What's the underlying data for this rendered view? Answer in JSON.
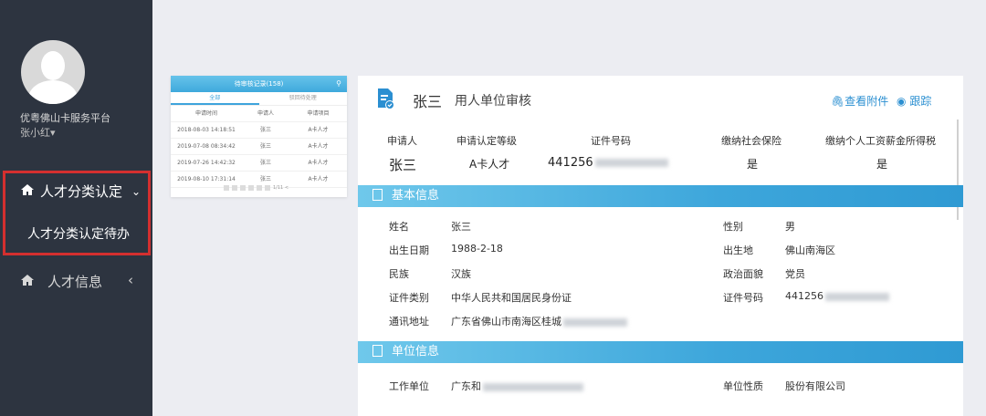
{
  "sidebar": {
    "platform": "优粤佛山卡服务平台",
    "user": "张小红▾",
    "menu_active": "人才分类认定",
    "menu_active_sub": "人才分类认定待办",
    "menu_other": "人才信息"
  },
  "mini": {
    "header": "待审核记录(158)",
    "tabs": [
      "全部",
      "驳回待处理"
    ],
    "columns": [
      "申请时间",
      "申请人",
      "申请项目"
    ],
    "rows": [
      [
        "2018-08-03 14:18:51",
        "张三",
        "A卡人才"
      ],
      [
        "2019-07-08 08:34:42",
        "张三",
        "A卡人才"
      ],
      [
        "2019-07-26 14:42:32",
        "张三",
        "A卡人才"
      ],
      [
        "2019-08-10 17:31:14",
        "张三",
        "A卡人才"
      ]
    ],
    "pager": "1/11 <"
  },
  "card": {
    "name": "张三",
    "title": "用人单位审核",
    "link_attachment": "查看附件",
    "link_track": "跟踪",
    "summary_labels": [
      "申请人",
      "申请认定等级",
      "证件号码",
      "缴纳社会保险",
      "缴纳个人工资薪金所得税"
    ],
    "summary_values": [
      "张三",
      "A卡人才",
      "441256",
      "是",
      "是"
    ],
    "basic_title": "基本信息",
    "basic": {
      "name_label": "姓名",
      "name": "张三",
      "gender_label": "性别",
      "gender": "男",
      "birth_label": "出生日期",
      "birth": "1988-2-18",
      "birthplace_label": "出生地",
      "birthplace": "佛山南海区",
      "ethnic_label": "民族",
      "ethnic": "汉族",
      "political_label": "政治面貌",
      "political": "党员",
      "idtype_label": "证件类别",
      "idtype": "中华人民共和国居民身份证",
      "idno_label": "证件号码",
      "idno": "441256",
      "addr_label": "通讯地址",
      "addr": "广东省佛山市南海区桂城"
    },
    "unit_title": "单位信息",
    "unit": {
      "work_label": "工作单位",
      "work": "广东和",
      "nature_label": "单位性质",
      "nature": "股份有限公司"
    }
  }
}
